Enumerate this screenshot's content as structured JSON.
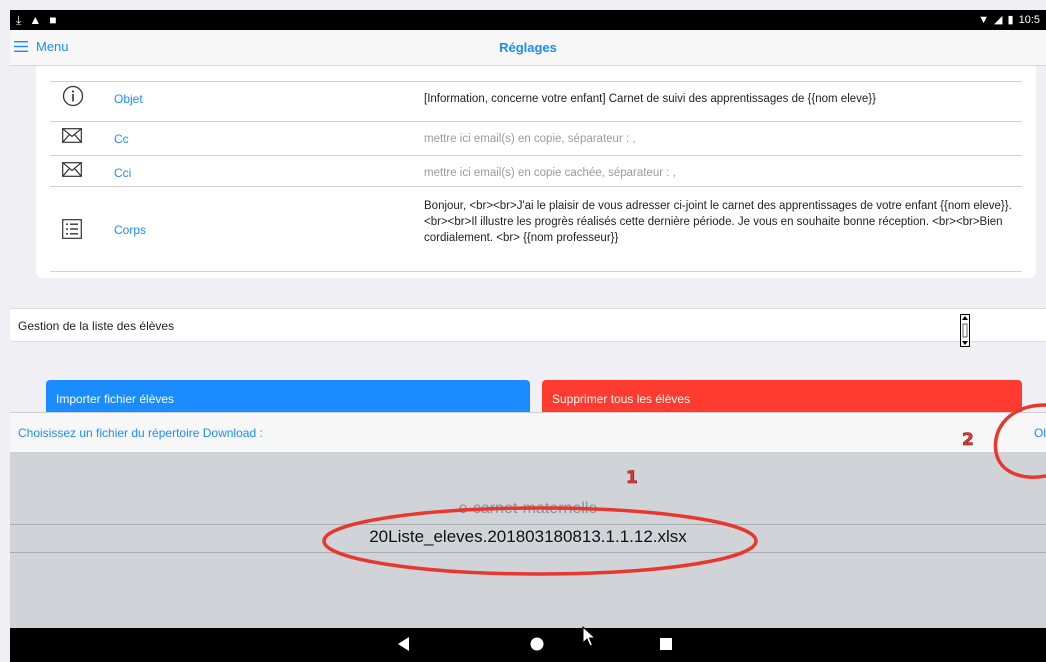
{
  "status_bar": {
    "time": "10:5",
    "icons": [
      "download-icon",
      "warning-icon",
      "bag-icon",
      "wifi-icon",
      "signal-icon",
      "battery-icon"
    ]
  },
  "nav": {
    "menu_label": "Menu",
    "title": "Réglages"
  },
  "email_form": {
    "rows": [
      {
        "icon": "info-icon",
        "label": "Objet",
        "value": "[Information, concerne votre enfant] Carnet de suivi des apprentissages de {{nom eleve}}",
        "placeholder": false
      },
      {
        "icon": "envelope-icon",
        "label": "Cc",
        "value": "mettre ici email(s) en copie, séparateur : ,",
        "placeholder": true
      },
      {
        "icon": "envelope-icon",
        "label": "Cci",
        "value": "mettre ici email(s) en copie cachée, séparateur : ,",
        "placeholder": true
      },
      {
        "icon": "list-icon",
        "label": "Corps",
        "value": "Bonjour, <br><br>J'ai le plaisir de vous adresser ci-joint le carnet des apprentissages de votre enfant {{nom eleve}}.<br><br>Il illustre les progrès réalisés cette dernière période. Je vous en souhaite bonne réception. <br><br>Bien cordialement. <br> {{nom professeur}}",
        "placeholder": false
      }
    ]
  },
  "students_section": {
    "title": "Gestion de la liste des élèves",
    "import_button": "Importer fichier élèves",
    "delete_button": "Supprimer tous les élèves"
  },
  "file_picker": {
    "prompt": "Choisissez un fichier du répertoire Download :",
    "ok_label": "Ol",
    "options": [
      "e-carnet-maternelle",
      "20Liste_eleves.201803180813.1.1.12.xlsx"
    ],
    "selected": "20Liste_eleves.201803180813.1.1.12.xlsx"
  },
  "annotations": {
    "marker_1": "1",
    "marker_2": "2",
    "color": "#e8372f"
  },
  "colors": {
    "accent_blue": "#1a8cff",
    "danger_red": "#ff3b30"
  }
}
